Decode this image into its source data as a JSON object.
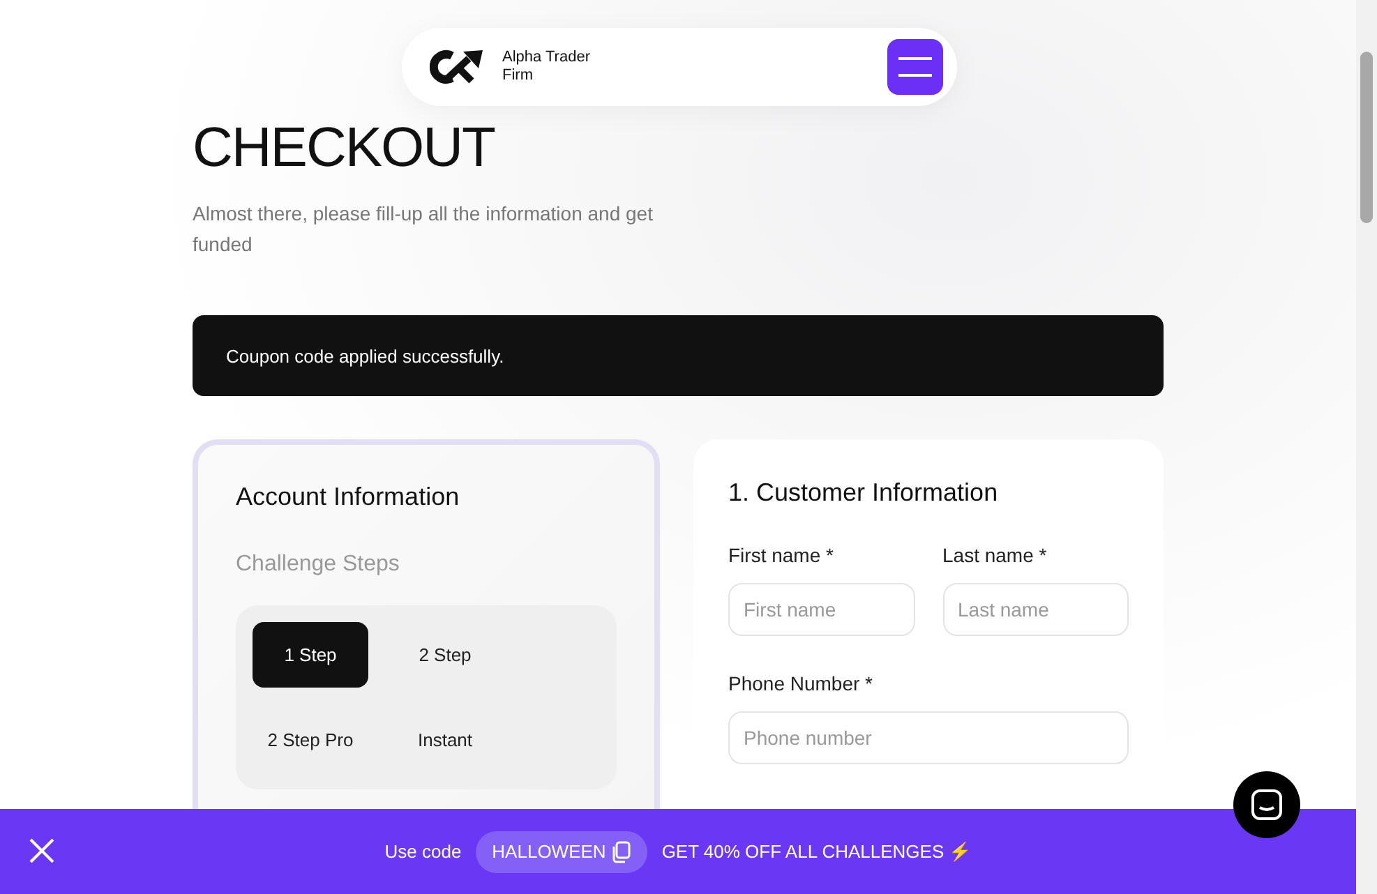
{
  "header": {
    "brand": "Alpha Trader\nFirm"
  },
  "page": {
    "title": "CHECKOUT",
    "subtitle": "Almost there, please fill-up all the information and get funded"
  },
  "notice": {
    "text": "Coupon code applied successfully."
  },
  "account": {
    "title": "Account Information",
    "steps_label": "Challenge Steps",
    "steps": [
      {
        "label": "1 Step",
        "selected": true
      },
      {
        "label": "2 Step",
        "selected": false
      },
      {
        "label": "2 Step Pro",
        "selected": false
      },
      {
        "label": "Instant",
        "selected": false
      }
    ]
  },
  "customer": {
    "title": "1. Customer Information",
    "fields": [
      {
        "label": "First name *",
        "placeholder": "First name",
        "kind": "half"
      },
      {
        "label": "Last name *",
        "placeholder": "Last name",
        "kind": "half"
      },
      {
        "label": "Phone Number *",
        "placeholder": "Phone number",
        "kind": "full"
      }
    ]
  },
  "promo": {
    "prefix": "Use code",
    "code": "HALLOWEEN",
    "offer": "GET 40% OFF ALL CHALLENGES ⚡"
  }
}
